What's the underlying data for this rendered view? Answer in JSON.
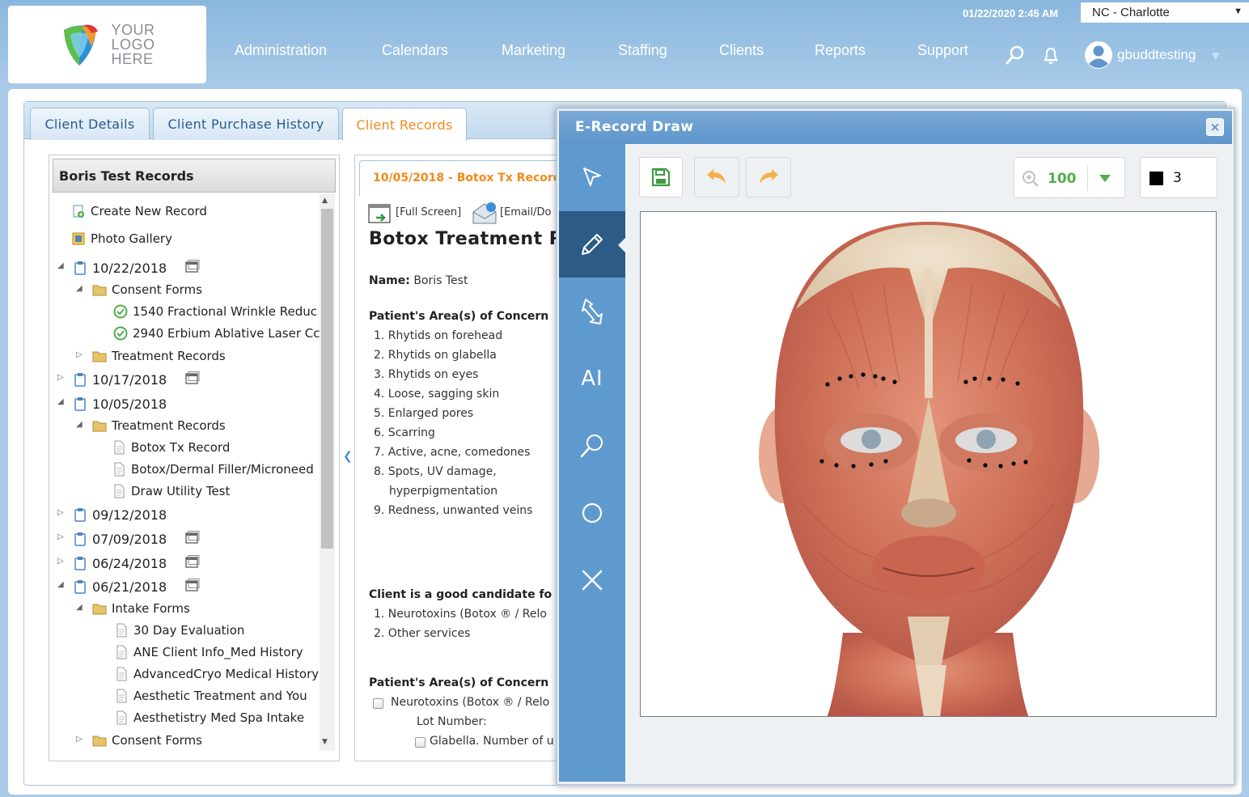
{
  "header": {
    "logo_line1": "YOUR",
    "logo_line2": "LOGO",
    "logo_line3": "HERE",
    "datetime": "01/22/2020 2:45 AM",
    "location": "NC - Charlotte",
    "nav": [
      "Administration",
      "Calendars",
      "Marketing",
      "Staffing",
      "Clients",
      "Reports",
      "Support"
    ],
    "username": "gbuddtesting"
  },
  "tabs": {
    "client_details": "Client Details",
    "purchase_history": "Client Purchase History",
    "client_records": "Client Records"
  },
  "tree": {
    "title": "Boris Test Records",
    "create_new": "Create New Record",
    "photo_gallery": "Photo Gallery",
    "items": [
      "10/22/2018",
      "Consent Forms",
      "1540 Fractional Wrinkle Reduc",
      "2940 Erbium Ablative Laser Cc",
      "Treatment Records",
      "10/17/2018",
      "10/05/2018",
      "Treatment Records",
      "Botox Tx Record",
      "Botox/Dermal Filler/Microneed",
      "Draw Utility Test",
      "09/12/2018",
      "07/09/2018",
      "06/24/2018",
      "06/21/2018",
      "Intake Forms",
      "30 Day Evaluation",
      "ANE Client Info_Med History",
      "AdvancedCryo Medical History",
      "Aesthetic Treatment and You",
      "Aesthetistry Med Spa Intake",
      "Consent Forms"
    ]
  },
  "doc": {
    "tab_label": "10/05/2018 - Botox Tx Record",
    "full_screen": "[Full Screen]",
    "email": "[Email/Do",
    "title": "Botox Treatment R",
    "name_label": "Name:",
    "name_value": "Boris Test",
    "concern_heading": "Patient's Area(s) of Concern",
    "concerns": [
      "1.  Rhytids on forehead",
      "2.  Rhytids on glabella",
      "3.  Rhytids on eyes",
      "4.  Loose, sagging skin",
      "5.  Enlarged pores",
      "6.  Scarring",
      "7.  Active, acne, comedones",
      "8.  Spots, UV damage,",
      "hyperpigmentation",
      "9.  Redness, unwanted veins"
    ],
    "candidate_heading": "Client is a good candidate fo",
    "candidate_items": [
      "1.  Neurotoxins (Botox ® / Relo",
      "2.  Other services"
    ],
    "concern_heading2": "Patient's Area(s) of Concern",
    "neuro_check": "Neurotoxins (Botox ® / Relo",
    "lot_number": "Lot Number:",
    "glabella": "Glabella. Number of u"
  },
  "modal": {
    "title": "E-Record Draw",
    "close": "×",
    "ai_tool": "AI",
    "zoom": "100",
    "brush_size": "3",
    "brush_color": "#000000"
  }
}
